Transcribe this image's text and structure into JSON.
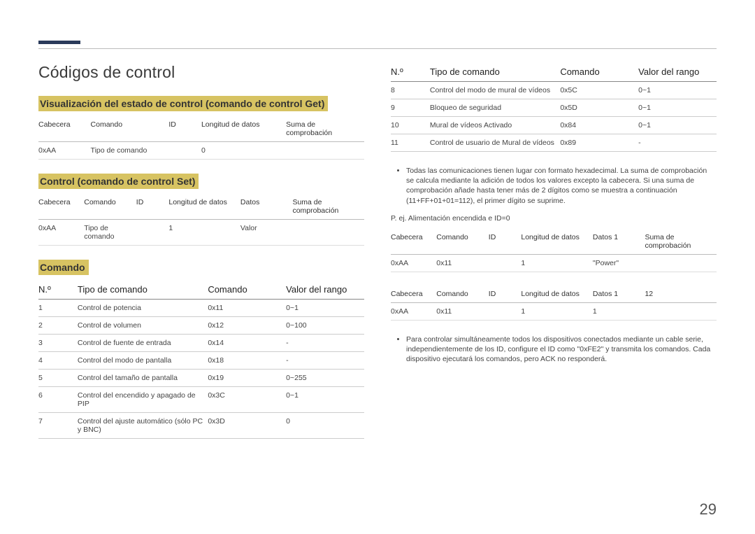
{
  "page_number": "29",
  "left": {
    "title": "Códigos de control",
    "section_get": {
      "heading": "Visualización del estado de control (comando de control Get)",
      "headers": [
        "Cabecera",
        "Comando",
        "ID",
        "Longitud de datos",
        "Suma de comprobación"
      ],
      "row": [
        "0xAA",
        "Tipo de comando",
        "",
        "0",
        ""
      ]
    },
    "section_set": {
      "heading": "Control (comando de control Set)",
      "headers": [
        "Cabecera",
        "Comando",
        "ID",
        "Longitud de datos",
        "Datos",
        "Suma de comprobación"
      ],
      "row": [
        "0xAA",
        "Tipo de comando",
        "",
        "1",
        "Valor",
        ""
      ]
    },
    "section_cmd": {
      "heading": "Comando",
      "headers": [
        "N.º",
        "Tipo de comando",
        "Comando",
        "Valor del rango"
      ],
      "rows": [
        [
          "1",
          "Control de potencia",
          "0x11",
          "0~1"
        ],
        [
          "2",
          "Control de volumen",
          "0x12",
          "0~100"
        ],
        [
          "3",
          "Control de fuente de entrada",
          "0x14",
          "-"
        ],
        [
          "4",
          "Control del modo de pantalla",
          "0x18",
          "-"
        ],
        [
          "5",
          "Control del tamaño de pantalla",
          "0x19",
          "0~255"
        ],
        [
          "6",
          "Control del encendido y apagado de PIP",
          "0x3C",
          "0~1"
        ],
        [
          "7",
          "Control del ajuste automático (sólo PC y BNC)",
          "0x3D",
          "0"
        ]
      ]
    }
  },
  "right": {
    "section_cmd_cont": {
      "headers": [
        "N.º",
        "Tipo de comando",
        "Comando",
        "Valor del rango"
      ],
      "rows": [
        [
          "8",
          "Control del modo de mural de vídeos",
          "0x5C",
          "0~1"
        ],
        [
          "9",
          "Bloqueo de seguridad",
          "0x5D",
          "0~1"
        ],
        [
          "10",
          "Mural de vídeos Activado",
          "0x84",
          "0~1"
        ],
        [
          "11",
          "Control de usuario de Mural de vídeos",
          "0x89",
          "-"
        ]
      ]
    },
    "note1": "Todas las comunicaciones tienen lugar con formato hexadecimal. La suma de comprobación se calcula mediante la adición de todos los valores excepto la cabecera. Si una suma de comprobación añade hasta tener más de 2 dígitos como se muestra a continuación (11+FF+01+01=112), el primer dígito se suprime.",
    "example_label": "P. ej. Alimentación encendida e ID=0",
    "ex_table1": {
      "headers": [
        "Cabecera",
        "Comando",
        "ID",
        "Longitud de datos",
        "Datos 1",
        "Suma de comprobación"
      ],
      "row": [
        "0xAA",
        "0x11",
        "",
        "1",
        "\"Power\"",
        ""
      ]
    },
    "ex_table2": {
      "headers": [
        "Cabecera",
        "Comando",
        "ID",
        "Longitud de datos",
        "Datos 1",
        "12"
      ],
      "row": [
        "0xAA",
        "0x11",
        "",
        "1",
        "1",
        ""
      ]
    },
    "note2": "Para controlar simultáneamente todos los dispositivos conectados mediante un cable serie, independientemente de los ID, configure el ID como \"0xFE2\" y transmita los comandos. Cada dispositivo ejecutará los comandos, pero ACK no responderá."
  }
}
